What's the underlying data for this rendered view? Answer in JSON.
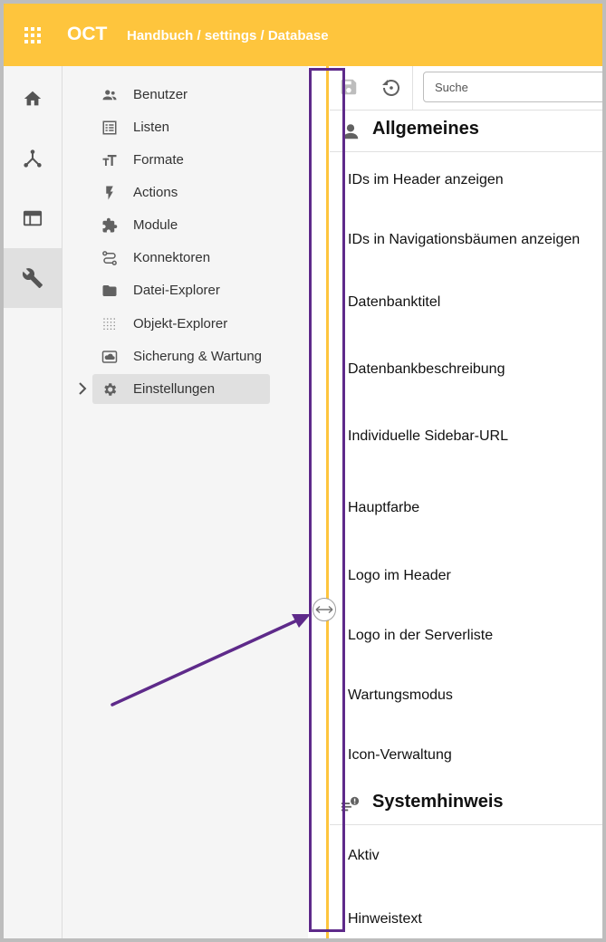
{
  "header": {
    "brand": "OCT",
    "breadcrumb": "Handbuch / settings / Database"
  },
  "rail": {
    "items": [
      {
        "icon": "home-icon",
        "active": false
      },
      {
        "icon": "hierarchy-icon",
        "active": false
      },
      {
        "icon": "layout-icon",
        "active": false
      },
      {
        "icon": "wrench-icon",
        "active": true
      }
    ]
  },
  "nav": {
    "items": [
      {
        "label": "Benutzer",
        "icon": "users-icon"
      },
      {
        "label": "Listen",
        "icon": "list-icon"
      },
      {
        "label": "Formate",
        "icon": "text-format-icon"
      },
      {
        "label": "Actions",
        "icon": "bolt-icon"
      },
      {
        "label": "Module",
        "icon": "puzzle-icon"
      },
      {
        "label": "Konnektoren",
        "icon": "route-icon"
      },
      {
        "label": "Datei-Explorer",
        "icon": "folder-icon"
      },
      {
        "label": "Objekt-Explorer",
        "icon": "dot-grid-icon"
      },
      {
        "label": "Sicherung & Wartung",
        "icon": "cloud-backup-icon"
      },
      {
        "label": "Einstellungen",
        "icon": "gear-icon",
        "active": true
      }
    ]
  },
  "toolbar": {
    "search_placeholder": "Suche"
  },
  "sections": [
    {
      "title": "Allgemeines",
      "icon": "person-icon",
      "settings": [
        "IDs im Header anzeigen",
        "IDs in Navigationsbäumen anzeigen",
        "Datenbanktitel",
        "Datenbankbeschreibung",
        "Individuelle Sidebar-URL",
        "Hauptfarbe",
        "Logo im Header",
        "Logo in der Serverliste",
        "Wartungsmodus",
        "Icon-Verwaltung"
      ]
    },
    {
      "title": "Systemhinweis",
      "icon": "notice-icon",
      "settings": [
        "Aktiv",
        "Hinweistext"
      ]
    }
  ],
  "colors": {
    "accent": "#fec53d",
    "annotation": "#5e2a8a"
  }
}
